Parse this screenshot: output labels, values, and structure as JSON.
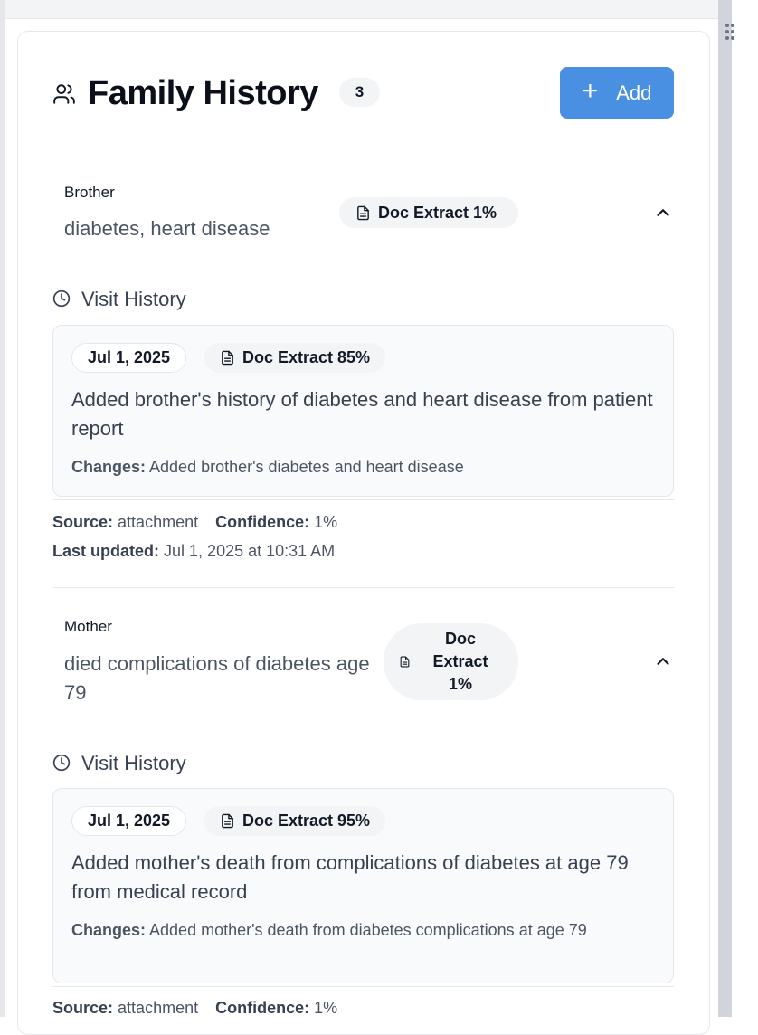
{
  "section": {
    "title": "Family History",
    "count": "3",
    "add_label": "Add"
  },
  "entries": [
    {
      "relation": "Brother",
      "condition": "diabetes, heart disease",
      "source_badge": "Doc Extract 1%",
      "visit_history_label": "Visit History",
      "visit": {
        "date": "Jul 1, 2025",
        "source_badge": "Doc Extract 85%",
        "description": "Added brother's history of diabetes and heart disease from patient report",
        "changes_label": "Changes:",
        "changes": "Added brother's diabetes and heart disease"
      },
      "source_label": "Source:",
      "source": "attachment",
      "confidence_label": "Confidence:",
      "confidence": "1%",
      "updated_label": "Last updated:",
      "updated": "Jul 1, 2025 at 10:31 AM"
    },
    {
      "relation": "Mother",
      "condition": "died complications of diabetes age 79",
      "source_badge_lines": [
        "Doc",
        "Extract",
        "1%"
      ],
      "visit_history_label": "Visit History",
      "visit": {
        "date": "Jul 1, 2025",
        "source_badge": "Doc Extract 95%",
        "description": "Added mother's death from complications of diabetes at age 79 from medical record",
        "changes_label": "Changes:",
        "changes": "Added mother's death from diabetes complications at age 79"
      },
      "source_label": "Source:",
      "source": "attachment",
      "confidence_label": "Confidence:",
      "confidence": "1%"
    }
  ],
  "colors": {
    "accent": "#4a90e2",
    "badge_bg": "#f3f4f6",
    "card_border": "#e5e7eb",
    "entry_bg": "#f9fafb"
  },
  "icons": {
    "header": "users-icon",
    "add": "plus-icon",
    "badge": "document-icon",
    "collapse": "chevron-up-icon",
    "history": "clock-icon"
  }
}
